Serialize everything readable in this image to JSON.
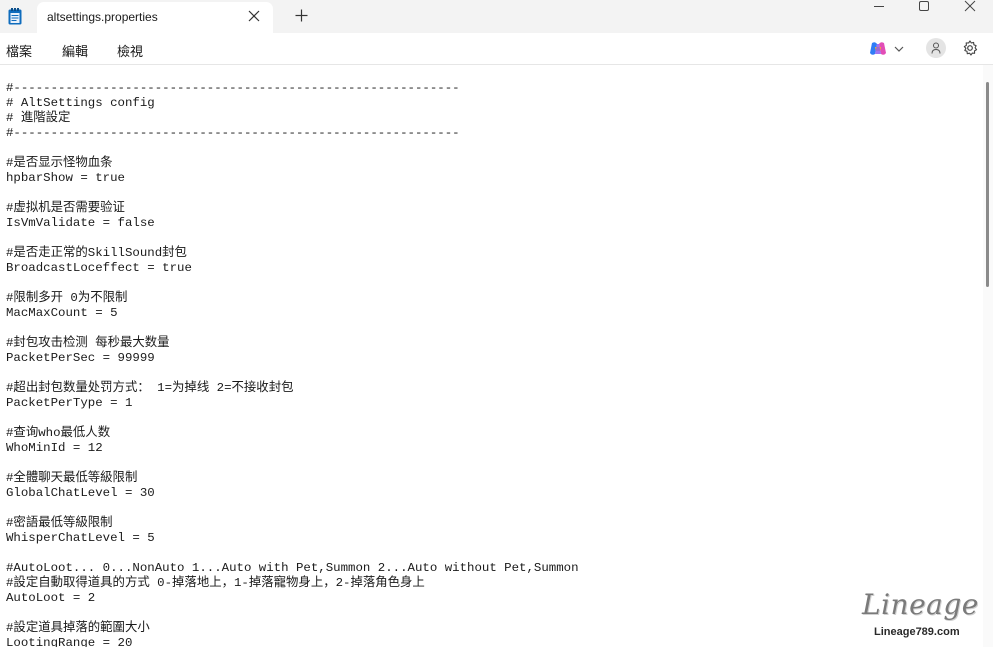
{
  "window": {
    "tab_title": "altsettings.properties"
  },
  "menu": {
    "file": "檔案",
    "edit": "編輯",
    "view": "檢視"
  },
  "editor": {
    "content": "#------------------------------------------------------------\n# AltSettings config\n# 進階設定\n#------------------------------------------------------------\n\n#是否显示怪物血条\nhpbarShow = true\n\n#虚拟机是否需要验证\nIsVmValidate = false\n\n#是否走正常的SkillSound封包\nBroadcastLoceffect = true\n\n#限制多开 0为不限制\nMacMaxCount = 5\n\n#封包攻击检测 每秒最大数量\nPacketPerSec = 99999\n\n#超出封包数量处罚方式： 1=为掉线 2=不接收封包\nPacketPerType = 1\n\n#查询who最低人数\nWhoMinId = 12\n\n#全體聊天最低等級限制\nGlobalChatLevel = 30\n\n#密語最低等級限制\nWhisperChatLevel = 5\n\n#AutoLoot... 0...NonAuto 1...Auto with Pet,Summon 2...Auto without Pet,Summon\n#設定自動取得道具的方式 0-掉落地上，1-掉落寵物身上，2-掉落角色身上\nAutoLoot = 2\n\n#設定道具掉落的範圍大小\nLootingRange = 20"
  },
  "watermark": {
    "logo_text": "Lineage",
    "url": "Lineage789.com"
  },
  "icons": {
    "app": "notepad-icon",
    "close_tab": "close-icon",
    "new_tab": "plus-icon",
    "copilot": "copilot-icon",
    "account": "person-icon",
    "settings": "gear-icon"
  },
  "colors": {
    "titlebar_bg": "#f3f3f3",
    "editor_bg": "#ffffff",
    "text": "#1a1a1a",
    "app_icon": "#0f6cbd"
  }
}
